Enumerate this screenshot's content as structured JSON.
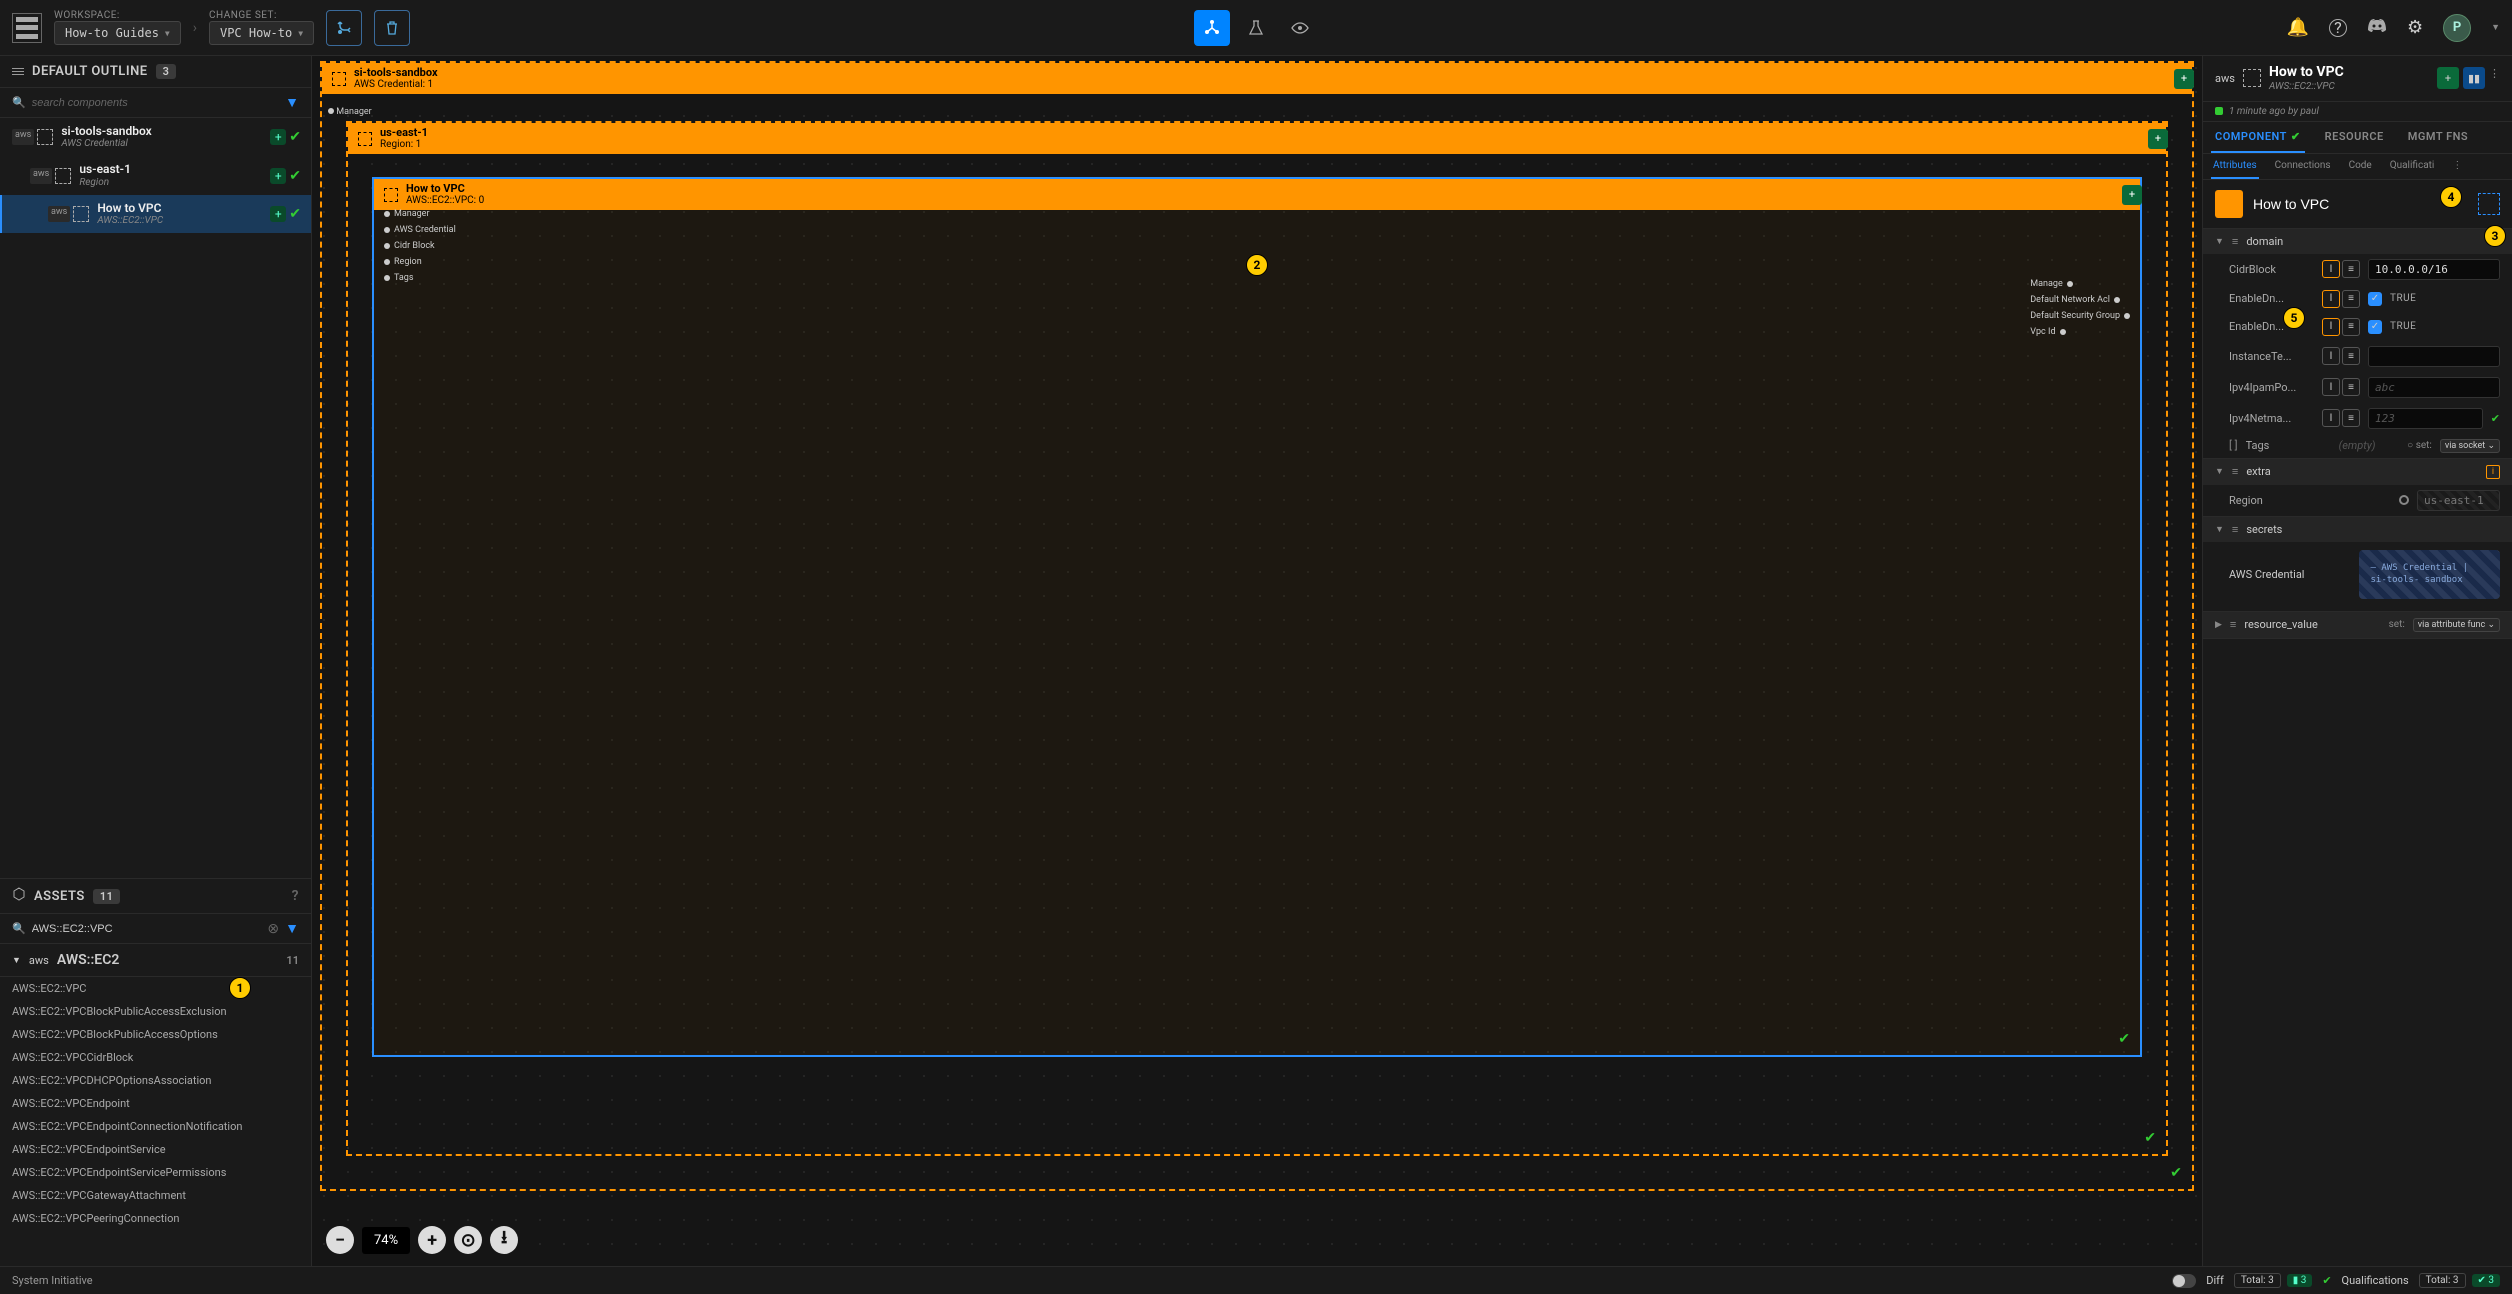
{
  "workspace": {
    "label": "WORKSPACE:",
    "value": "How-to Guides"
  },
  "changeset": {
    "label": "CHANGE SET:",
    "value": "VPC How-to"
  },
  "outline": {
    "title": "DEFAULT OUTLINE",
    "count": "3",
    "search_placeholder": "search components",
    "items": [
      {
        "name": "si-tools-sandbox",
        "sub": "AWS Credential"
      },
      {
        "name": "us-east-1",
        "sub": "Region"
      },
      {
        "name": "How to VPC",
        "sub": "AWS::EC2::VPC"
      }
    ]
  },
  "assets": {
    "title": "ASSETS",
    "count": "11",
    "search_value": "AWS::EC2::VPC",
    "group": {
      "name": "AWS::EC2",
      "count": "11"
    },
    "items": [
      "AWS::EC2::VPC",
      "AWS::EC2::VPCBlockPublicAccessExclusion",
      "AWS::EC2::VPCBlockPublicAccessOptions",
      "AWS::EC2::VPCCidrBlock",
      "AWS::EC2::VPCDHCPOptionsAssociation",
      "AWS::EC2::VPCEndpoint",
      "AWS::EC2::VPCEndpointConnectionNotification",
      "AWS::EC2::VPCEndpointService",
      "AWS::EC2::VPCEndpointServicePermissions",
      "AWS::EC2::VPCGatewayAttachment",
      "AWS::EC2::VPCPeeringConnection"
    ]
  },
  "canvas": {
    "frames": [
      {
        "title": "si-tools-sandbox",
        "sub": "AWS Credential: 1"
      },
      {
        "title": "us-east-1",
        "sub": "Region: 1"
      },
      {
        "title": "How to VPC",
        "sub": "AWS::EC2::VPC: 0"
      }
    ],
    "left_ports": [
      "Manager",
      "AWS Credential",
      "Cidr Block",
      "Region",
      "Tags"
    ],
    "right_ports": [
      "Manage",
      "Default Network Acl",
      "Default Security Group",
      "Vpc Id"
    ],
    "outer_port": "Manager",
    "zoom": "74%"
  },
  "right": {
    "title": "How to VPC",
    "sub": "AWS::EC2::VPC",
    "last_change_prefix": "1 minute ago ",
    "last_change_by": "by paul",
    "tabs": [
      "COMPONENT",
      "RESOURCE",
      "MGMT FNS"
    ],
    "subtabs": [
      "Attributes",
      "Connections",
      "Code",
      "Qualificati"
    ],
    "comp_name": "How to VPC",
    "domain": {
      "title": "domain",
      "attrs": {
        "cidr": {
          "label": "CidrBlock",
          "value": "10.0.0.0/16"
        },
        "dns1": {
          "label": "EnableDn...",
          "value": "TRUE"
        },
        "dns2": {
          "label": "EnableDn...",
          "value": "TRUE"
        },
        "tenancy": {
          "label": "InstanceTe...",
          "placeholder": ""
        },
        "ipam": {
          "label": "Ipv4IpamPo...",
          "placeholder": "abc"
        },
        "netmask": {
          "label": "Ipv4Netma...",
          "placeholder": "123"
        },
        "tags": {
          "label": "Tags",
          "empty": "(empty)",
          "set": "via socket ⌄"
        }
      }
    },
    "extra": {
      "title": "extra",
      "region": {
        "label": "Region",
        "value": "us-east-1"
      }
    },
    "secrets": {
      "title": "secrets",
      "cred": {
        "label": "AWS Credential",
        "card": "— AWS\nCredential |\nsi-tools-\nsandbox"
      }
    },
    "resource_value": {
      "title": "resource_value",
      "set": "set:",
      "via": "via attribute func ⌄"
    }
  },
  "status": {
    "brand": "System Initiative",
    "diff": "Diff",
    "diff_total_label": "Total:",
    "diff_total": "3",
    "diff_add": "3",
    "qual": "Qualifications",
    "qual_total_label": "Total:",
    "qual_total": "3",
    "qual_pass": "3"
  },
  "avatar": "P",
  "callouts": {
    "c1": "1",
    "c2": "2",
    "c3": "3",
    "c4": "4",
    "c5": "5"
  }
}
